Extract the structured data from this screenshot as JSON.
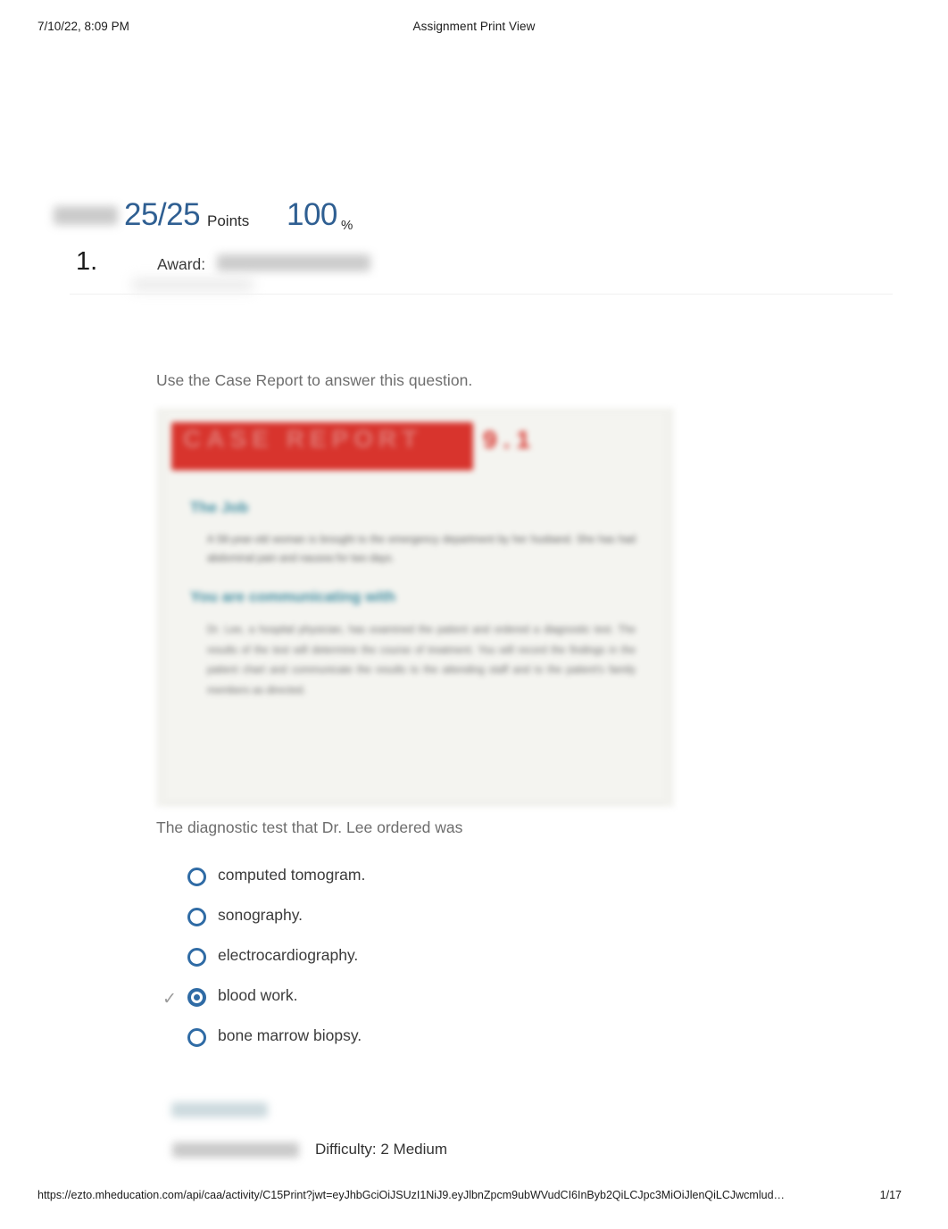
{
  "print_header": {
    "date": "7/10/22, 8:09 PM",
    "title": "Assignment Print View"
  },
  "score": {
    "points": "25/25",
    "points_label": "Points",
    "percent": "100",
    "percent_sign": "%"
  },
  "question": {
    "number": "1.",
    "award_label": "Award:",
    "lead_in": "Use the Case Report to answer this question.",
    "stem": "The diagnostic test that Dr. Lee ordered was",
    "options": [
      {
        "label": "computed tomogram.",
        "selected": false,
        "correct_mark": false
      },
      {
        "label": "sonography.",
        "selected": false,
        "correct_mark": false
      },
      {
        "label": "electrocardiography.",
        "selected": false,
        "correct_mark": false
      },
      {
        "label": "blood work.",
        "selected": true,
        "correct_mark": true
      },
      {
        "label": "bone marrow biopsy.",
        "selected": false,
        "correct_mark": false
      }
    ],
    "check_glyph": "✓"
  },
  "case_report_figure": {
    "banner_text": "CASE REPORT",
    "banner_number": "9.1",
    "heading_1": "The Job",
    "heading_2": "You are communicating with",
    "body_1": "A 58-year-old woman is brought to the emergency department by her husband. She has had abdominal pain and nausea for two days.",
    "body_2": "Dr. Lee, a hospital physician, has examined the patient and ordered a diagnostic test. The results of the test will determine the course of treatment. You will record the findings in the patient chart and communicate the results to the attending staff and to the patient's family members as directed."
  },
  "meta": {
    "difficulty": "Difficulty: 2 Medium"
  },
  "print_footer": {
    "url": "https://ezto.mheducation.com/api/caa/activity/C15Print?jwt=eyJhbGciOiJSUzI1NiJ9.eyJlbnZpcm9ubWVudCI6InByb2QiLCJpc3MiOiJlenQiLCJwcmlud…",
    "page": "1/17"
  },
  "colors": {
    "accent_blue": "#2f6ba5",
    "score_blue": "#2f5f92",
    "banner_red": "#d8342d",
    "heading_teal": "#3d8ca0",
    "check_gray": "#9b9b9b"
  }
}
